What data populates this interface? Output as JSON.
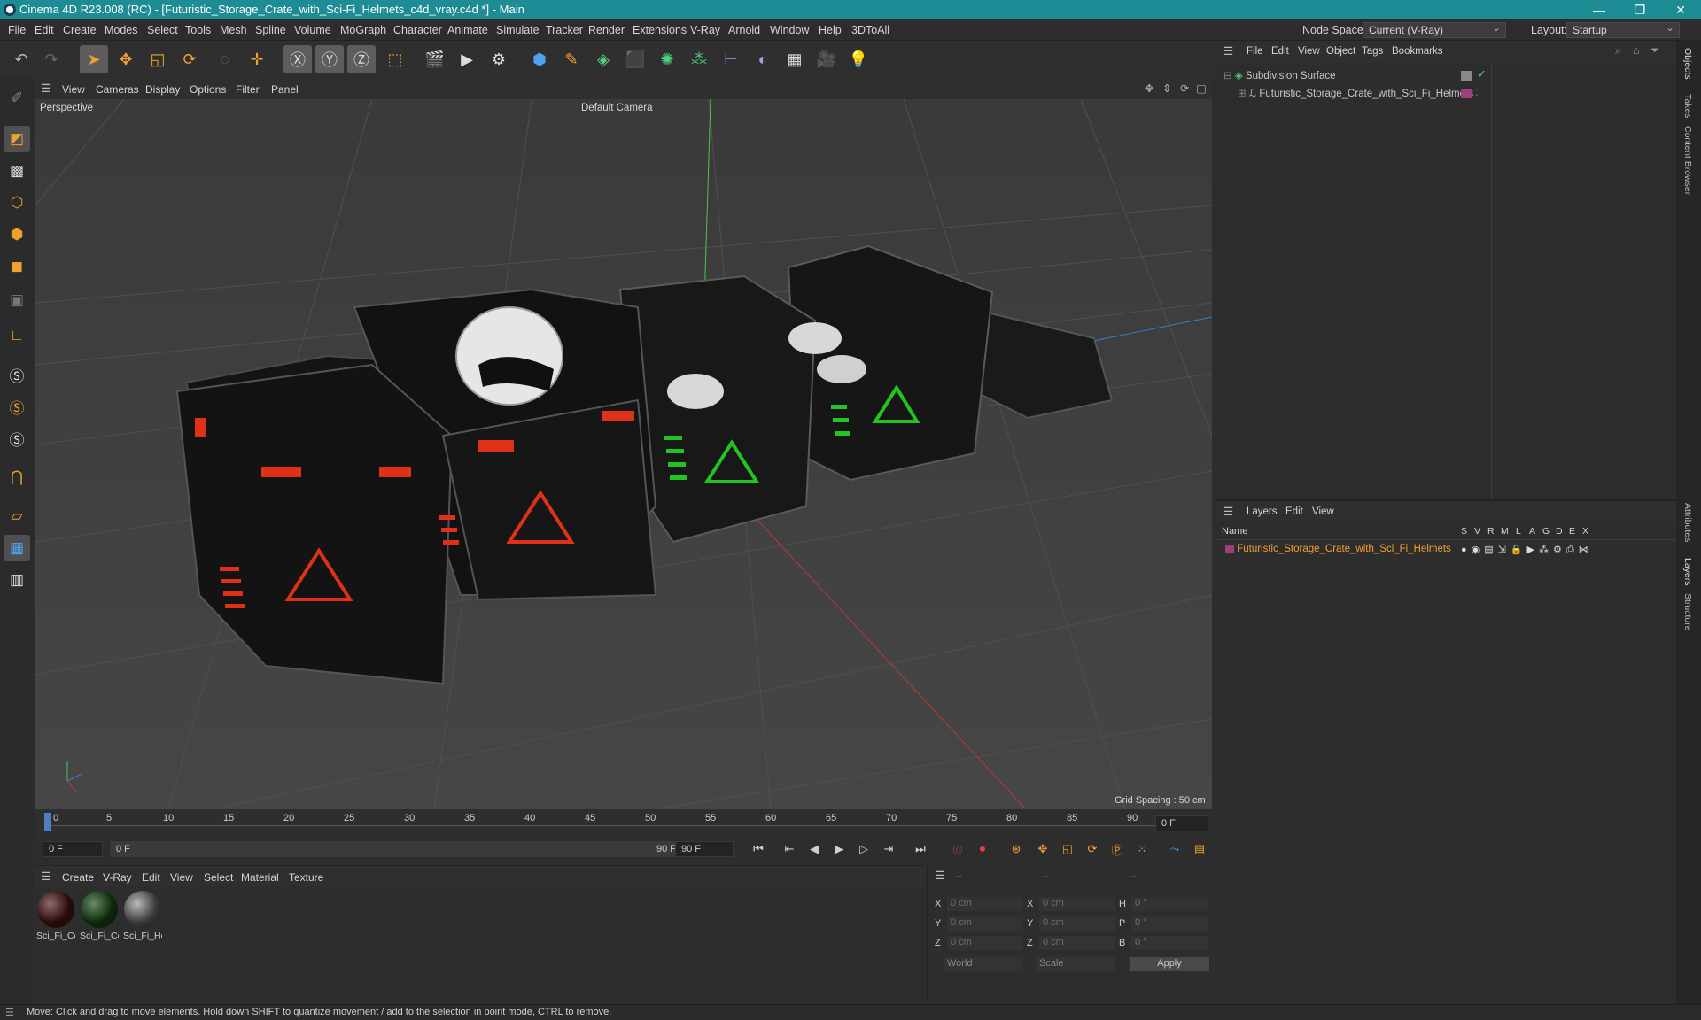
{
  "title": "Cinema 4D R23.008 (RC) - [Futuristic_Storage_Crate_with_Sci-Fi_Helmets_c4d_vray.c4d *] - Main",
  "menu": [
    "File",
    "Edit",
    "Create",
    "Modes",
    "Select",
    "Tools",
    "Mesh",
    "Spline",
    "Volume",
    "MoGraph",
    "Character",
    "Animate",
    "Simulate",
    "Tracker",
    "Render",
    "Extensions",
    "V-Ray",
    "Arnold",
    "Window",
    "Help",
    "3DToAll"
  ],
  "node_space": {
    "label": "Node Space:",
    "value": "Current (V-Ray)"
  },
  "layout": {
    "label": "Layout:",
    "value": "Startup"
  },
  "viewport": {
    "menu": [
      "View",
      "Cameras",
      "Display",
      "Options",
      "Filter",
      "Panel"
    ],
    "name": "Perspective",
    "camera": "Default Camera",
    "grid_spacing": "Grid Spacing : 50 cm"
  },
  "timeline": {
    "ticks": [
      "0",
      "5",
      "10",
      "15",
      "20",
      "25",
      "30",
      "35",
      "40",
      "45",
      "50",
      "55",
      "60",
      "65",
      "70",
      "75",
      "80",
      "85",
      "90"
    ],
    "current_frame": "0 F"
  },
  "transport": {
    "start": "0 F",
    "range_start": "0 F",
    "range_end": "90 F",
    "end": "90 F"
  },
  "materials": {
    "menu": [
      "Create",
      "V-Ray",
      "Edit",
      "View",
      "Select",
      "Material",
      "Texture"
    ],
    "items": [
      "Sci_Fi_Co",
      "Sci_Fi_Co",
      "Sci_Fi_He"
    ]
  },
  "coords": {
    "headers": [
      "--",
      "--",
      "--"
    ],
    "rows": [
      {
        "a": "X",
        "av": "0 cm",
        "b": "X",
        "bv": "0 cm",
        "c": "H",
        "cv": "0 °"
      },
      {
        "a": "Y",
        "av": "0 cm",
        "b": "Y",
        "bv": "0 cm",
        "c": "P",
        "cv": "0 °"
      },
      {
        "a": "Z",
        "av": "0 cm",
        "b": "Z",
        "bv": "0 cm",
        "c": "B",
        "cv": "0 °"
      }
    ],
    "world": "World",
    "scale": "Scale",
    "apply": "Apply"
  },
  "objects": {
    "menu": [
      "File",
      "Edit",
      "View",
      "Object",
      "Tags",
      "Bookmarks"
    ],
    "items": [
      "Subdivision Surface",
      "Futuristic_Storage_Crate_with_Sci_Fi_Helmets"
    ]
  },
  "layers": {
    "menu": [
      "Layers",
      "Edit",
      "View"
    ],
    "name_header": "Name",
    "flags": [
      "S",
      "V",
      "R",
      "M",
      "L",
      "A",
      "G",
      "D",
      "E",
      "X"
    ],
    "items": [
      "Futuristic_Storage_Crate_with_Sci_Fi_Helmets"
    ]
  },
  "right_tabs": [
    "Objects",
    "Takes",
    "Content Browser",
    "Attributes",
    "Layers",
    "Structure"
  ],
  "status": "Move: Click and drag to move elements. Hold down SHIFT to quantize movement / add to the selection in point mode, CTRL to remove.",
  "colors": {
    "titlebar": "#1e8c95",
    "accent": "#f0a030",
    "layer": "#a0407a"
  }
}
